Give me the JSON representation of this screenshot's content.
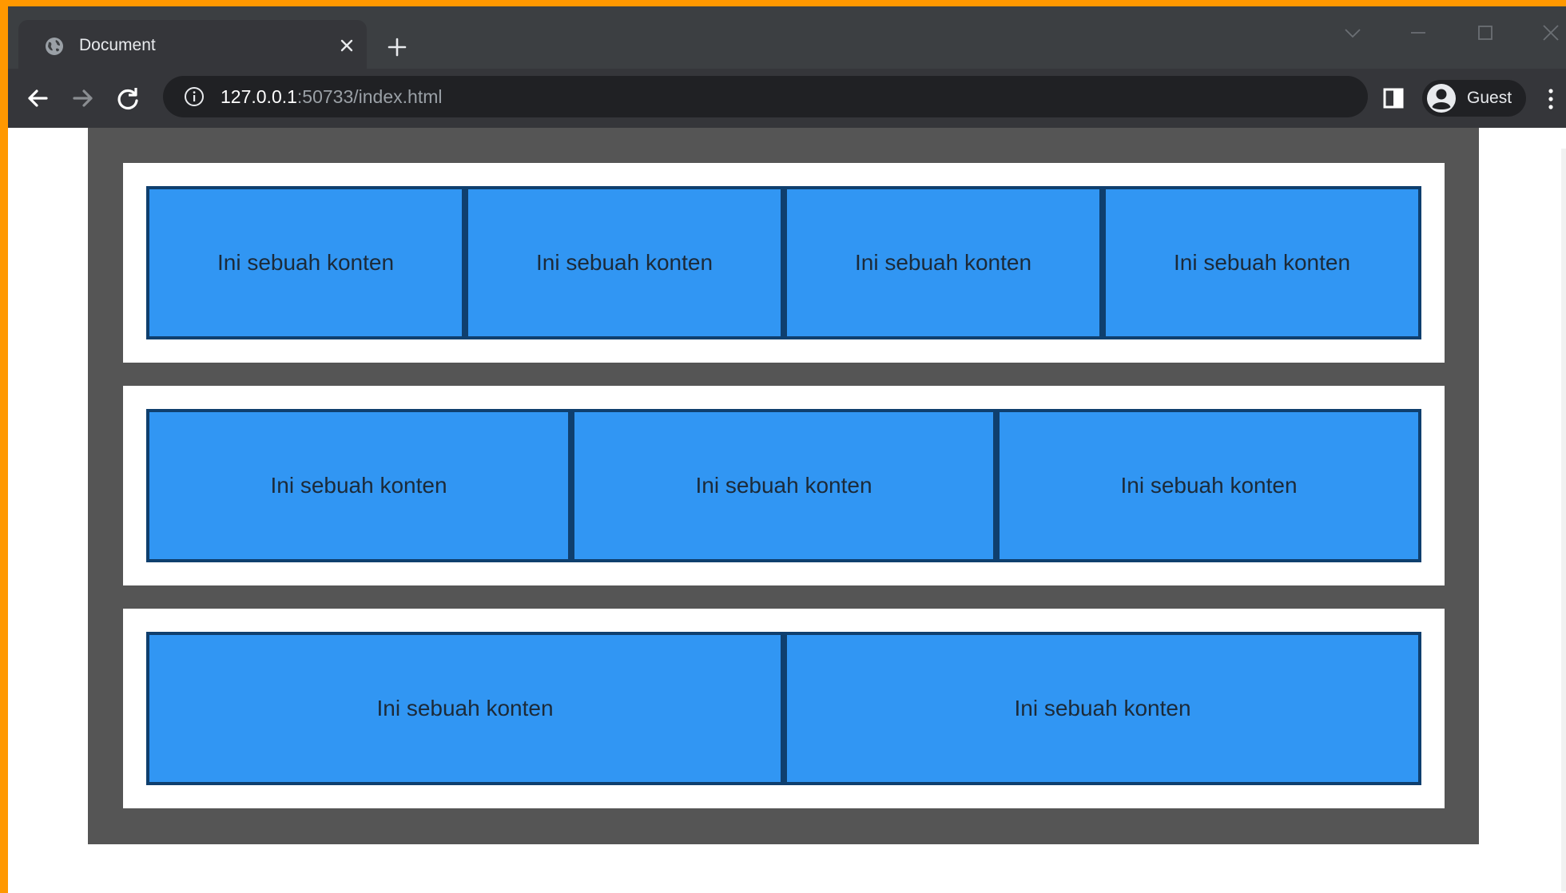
{
  "browser": {
    "tab": {
      "title": "Document",
      "favicon": "globe-icon"
    },
    "address_bar": {
      "host": "127.0.0.1",
      "rest": ":50733/index.html"
    },
    "profile": {
      "label": "Guest"
    },
    "icons": {
      "back": "arrow-left-icon",
      "forward": "arrow-right-icon",
      "reload": "reload-icon",
      "info": "info-icon",
      "side_panel": "side-panel-icon",
      "menu": "more-vertical-icon",
      "new_tab": "plus-icon",
      "tab_search": "chevron-down-icon",
      "minimize": "minimize-icon",
      "maximize": "maximize-icon",
      "close": "close-icon"
    }
  },
  "page": {
    "rows": [
      {
        "boxes": [
          "Ini sebuah konten",
          "Ini sebuah konten",
          "Ini sebuah konten",
          "Ini sebuah konten"
        ]
      },
      {
        "boxes": [
          "Ini sebuah konten",
          "Ini sebuah konten",
          "Ini sebuah konten"
        ]
      },
      {
        "boxes": [
          "Ini sebuah konten",
          "Ini sebuah konten"
        ]
      }
    ]
  },
  "colors": {
    "frame": "#ff9800",
    "container": "#555555",
    "row_background": "#ffffff",
    "box_fill": "#3196f3",
    "box_border": "#0f3f6e"
  }
}
